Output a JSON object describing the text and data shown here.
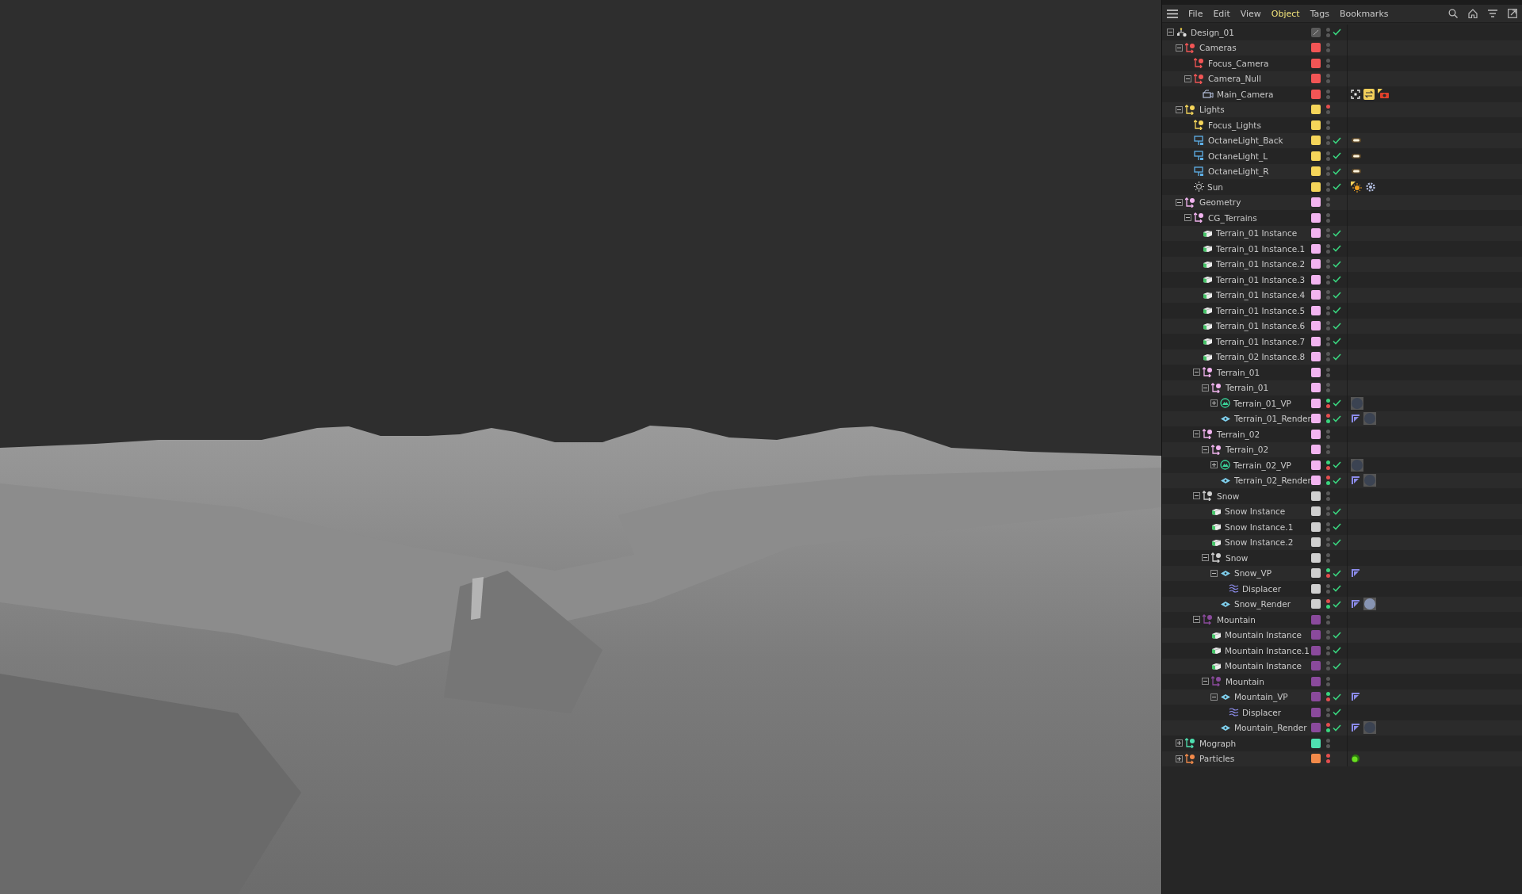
{
  "menu": [
    {
      "label": "File",
      "selected": false
    },
    {
      "label": "Edit",
      "selected": false
    },
    {
      "label": "View",
      "selected": false
    },
    {
      "label": "Object",
      "selected": true
    },
    {
      "label": "Tags",
      "selected": false
    },
    {
      "label": "Bookmarks",
      "selected": false
    }
  ],
  "objects": [
    {
      "name": "Design_01",
      "kind": "root",
      "expanded": true,
      "color": "#5a5a5a",
      "enabled": true,
      "children": [
        {
          "name": "Cameras",
          "kind": "null",
          "expanded": true,
          "color": "#f25555",
          "enabled": false,
          "children": [
            {
              "name": "Focus_Camera",
              "kind": "null",
              "color": "#f25555",
              "enabled": false
            },
            {
              "name": "Camera_Null",
              "kind": "null",
              "expanded": true,
              "color": "#f25555",
              "enabled": false,
              "children": [
                {
                  "name": "Main_Camera",
                  "kind": "camera",
                  "color": "#f25555",
                  "enabled": false,
                  "tags": [
                    {
                      "kind": "focus"
                    },
                    {
                      "kind": "octane-camera"
                    },
                    {
                      "kind": "camera-tag"
                    }
                  ]
                }
              ]
            }
          ]
        },
        {
          "name": "Lights",
          "kind": "null",
          "expanded": true,
          "color": "#f5d55a",
          "editor_on": false,
          "enabled": false,
          "children": [
            {
              "name": "Focus_Lights",
              "kind": "null",
              "color": "#f5d55a",
              "enabled": false
            },
            {
              "name": "OctaneLight_Back",
              "kind": "light",
              "color": "#f5d55a",
              "enabled": true,
              "tags": [
                {
                  "kind": "light"
                }
              ]
            },
            {
              "name": "OctaneLight_L",
              "kind": "light",
              "color": "#f5d55a",
              "enabled": true,
              "tags": [
                {
                  "kind": "light"
                }
              ]
            },
            {
              "name": "OctaneLight_R",
              "kind": "light",
              "color": "#f5d55a",
              "enabled": true,
              "tags": [
                {
                  "kind": "light"
                }
              ]
            },
            {
              "name": "Sun",
              "kind": "sun",
              "color": "#f5d55a",
              "enabled": true,
              "tags": [
                {
                  "kind": "sun"
                },
                {
                  "kind": "sky"
                }
              ]
            }
          ]
        },
        {
          "name": "Geometry",
          "kind": "null",
          "expanded": true,
          "color": "#f2b4f0",
          "enabled": false,
          "children": [
            {
              "name": "CG_Terrains",
              "kind": "null",
              "expanded": true,
              "color": "#f2b4f0",
              "enabled": false,
              "children": [
                {
                  "name": "Terrain_01 Instance",
                  "kind": "instance",
                  "color": "#f2b4f0",
                  "enabled": true
                },
                {
                  "name": "Terrain_01 Instance.1",
                  "kind": "instance",
                  "color": "#f2b4f0",
                  "enabled": true
                },
                {
                  "name": "Terrain_01 Instance.2",
                  "kind": "instance",
                  "color": "#f2b4f0",
                  "enabled": true
                },
                {
                  "name": "Terrain_01 Instance.3",
                  "kind": "instance",
                  "color": "#f2b4f0",
                  "enabled": true
                },
                {
                  "name": "Terrain_01 Instance.4",
                  "kind": "instance",
                  "color": "#f2b4f0",
                  "enabled": true
                },
                {
                  "name": "Terrain_01 Instance.5",
                  "kind": "instance",
                  "color": "#f2b4f0",
                  "enabled": true
                },
                {
                  "name": "Terrain_01 Instance.6",
                  "kind": "instance",
                  "color": "#f2b4f0",
                  "enabled": true
                },
                {
                  "name": "Terrain_01 Instance.7",
                  "kind": "instance",
                  "color": "#f2b4f0",
                  "enabled": true
                },
                {
                  "name": "Terrain_02 Instance.8",
                  "kind": "instance",
                  "color": "#f2b4f0",
                  "enabled": true
                },
                {
                  "name": "Terrain_01",
                  "kind": "null",
                  "expanded": true,
                  "color": "#f2b4f0",
                  "enabled": false,
                  "children": [
                    {
                      "name": "Terrain_01",
                      "kind": "null",
                      "expanded": true,
                      "color": "#f2b4f0",
                      "enabled": false,
                      "children": [
                        {
                          "name": "Terrain_01_VP",
                          "kind": "vdb",
                          "expanded": false,
                          "color": "#f2b4f0",
                          "editor_on": true,
                          "render_on": false,
                          "enabled": true,
                          "tags": [
                            {
                              "kind": "material",
                              "color": "#3b4352"
                            }
                          ]
                        },
                        {
                          "name": "Terrain_01_Render",
                          "kind": "volume",
                          "color": "#f2b4f0",
                          "editor_on": false,
                          "render_on": true,
                          "enabled": true,
                          "tags": [
                            {
                              "kind": "vertex-map"
                            },
                            {
                              "kind": "material",
                              "color": "#3b4352"
                            }
                          ]
                        }
                      ]
                    }
                  ]
                },
                {
                  "name": "Terrain_02",
                  "kind": "null",
                  "expanded": true,
                  "color": "#f2b4f0",
                  "enabled": false,
                  "children": [
                    {
                      "name": "Terrain_02",
                      "kind": "null",
                      "expanded": true,
                      "color": "#f2b4f0",
                      "enabled": false,
                      "children": [
                        {
                          "name": "Terrain_02_VP",
                          "kind": "vdb",
                          "expanded": false,
                          "color": "#f2b4f0",
                          "editor_on": true,
                          "render_on": false,
                          "enabled": true,
                          "tags": [
                            {
                              "kind": "material",
                              "color": "#3b4352"
                            }
                          ]
                        },
                        {
                          "name": "Terrain_02_Render",
                          "kind": "volume",
                          "color": "#f2b4f0",
                          "editor_on": false,
                          "render_on": true,
                          "enabled": true,
                          "tags": [
                            {
                              "kind": "vertex-map"
                            },
                            {
                              "kind": "material",
                              "color": "#3b4352"
                            }
                          ]
                        }
                      ]
                    }
                  ]
                },
                {
                  "name": "Snow",
                  "kind": "null",
                  "expanded": true,
                  "color": "#d0d0d0",
                  "enabled": false,
                  "children": [
                    {
                      "name": "Snow Instance",
                      "kind": "instance",
                      "color": "#d0d0d0",
                      "enabled": true
                    },
                    {
                      "name": "Snow Instance.1",
                      "kind": "instance",
                      "color": "#d0d0d0",
                      "enabled": true
                    },
                    {
                      "name": "Snow Instance.2",
                      "kind": "instance",
                      "color": "#d0d0d0",
                      "enabled": true
                    },
                    {
                      "name": "Snow",
                      "kind": "null",
                      "expanded": true,
                      "color": "#d0d0d0",
                      "enabled": false,
                      "children": [
                        {
                          "name": "Snow_VP",
                          "kind": "volume",
                          "expanded": true,
                          "color": "#d0d0d0",
                          "editor_on": true,
                          "render_on": false,
                          "enabled": true,
                          "tags": [
                            {
                              "kind": "vertex-map"
                            }
                          ],
                          "children": [
                            {
                              "name": "Displacer",
                              "kind": "displacer",
                              "color": "#d0d0d0",
                              "enabled": true
                            }
                          ]
                        },
                        {
                          "name": "Snow_Render",
                          "kind": "volume",
                          "color": "#d0d0d0",
                          "editor_on": false,
                          "render_on": true,
                          "enabled": true,
                          "tags": [
                            {
                              "kind": "vertex-map"
                            },
                            {
                              "kind": "material",
                              "color": "#8794b2"
                            }
                          ]
                        }
                      ]
                    }
                  ]
                },
                {
                  "name": "Mountain",
                  "kind": "null",
                  "expanded": true,
                  "color": "#8a4a9c",
                  "enabled": false,
                  "children": [
                    {
                      "name": "Mountain Instance",
                      "kind": "instance",
                      "color": "#8a4a9c",
                      "enabled": true
                    },
                    {
                      "name": "Mountain Instance.1",
                      "kind": "instance",
                      "color": "#8a4a9c",
                      "enabled": true
                    },
                    {
                      "name": "Mountain Instance",
                      "kind": "instance",
                      "color": "#8a4a9c",
                      "enabled": true
                    },
                    {
                      "name": "Mountain",
                      "kind": "null",
                      "expanded": true,
                      "color": "#8a4a9c",
                      "enabled": false,
                      "children": [
                        {
                          "name": "Mountain_VP",
                          "kind": "volume",
                          "expanded": true,
                          "color": "#8a4a9c",
                          "editor_on": true,
                          "render_on": false,
                          "enabled": true,
                          "tags": [
                            {
                              "kind": "vertex-map"
                            }
                          ],
                          "children": [
                            {
                              "name": "Displacer",
                              "kind": "displacer",
                              "color": "#8a4a9c",
                              "enabled": true
                            }
                          ]
                        },
                        {
                          "name": "Mountain_Render",
                          "kind": "volume",
                          "color": "#8a4a9c",
                          "editor_on": false,
                          "render_on": true,
                          "enabled": true,
                          "tags": [
                            {
                              "kind": "vertex-map"
                            },
                            {
                              "kind": "material",
                              "color": "#3b4352"
                            }
                          ]
                        }
                      ]
                    }
                  ]
                }
              ]
            }
          ]
        },
        {
          "name": "Mograph",
          "kind": "null",
          "expanded": false,
          "color": "#4fe0b0",
          "enabled": false
        },
        {
          "name": "Particles",
          "kind": "null",
          "expanded": false,
          "color": "#f28a4a",
          "editor_on": false,
          "render_on": false,
          "enabled": false,
          "tags": [
            {
              "kind": "emitter"
            }
          ]
        }
      ]
    }
  ]
}
